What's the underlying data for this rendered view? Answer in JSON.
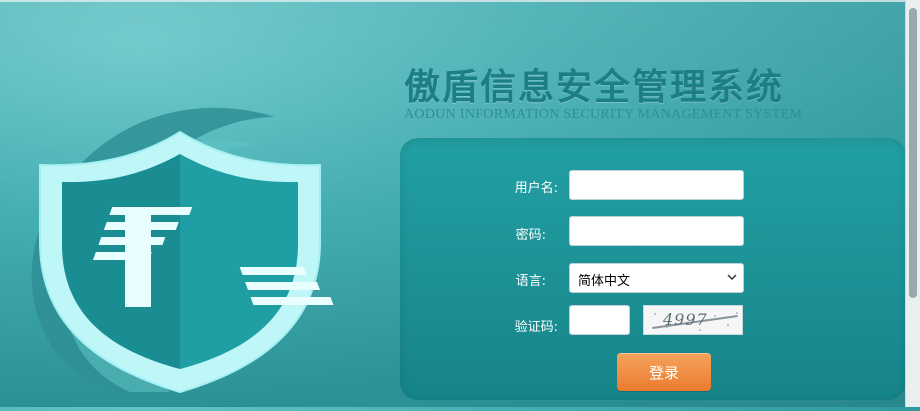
{
  "app": {
    "title_cn": "傲盾信息安全管理系统",
    "title_en": "AODUN INFORMATION SECURITY MANAGEMENT SYSTEM"
  },
  "login_form": {
    "username_label": "用户名:",
    "password_label": "密码:",
    "language_label": "语言:",
    "captcha_label": "验证码:",
    "language_selected": "简体中文",
    "captcha_value": "4997",
    "username_value": "",
    "password_value": "",
    "captcha_input_value": "",
    "login_button": "登录"
  },
  "colors": {
    "background": "#45aeb2",
    "panel": "#1c9196",
    "title": "#1d7e86",
    "button": "#ec7b2f"
  },
  "icons": {
    "logo": "shield-k-icon",
    "select_chevron": "chevron-down-icon"
  }
}
